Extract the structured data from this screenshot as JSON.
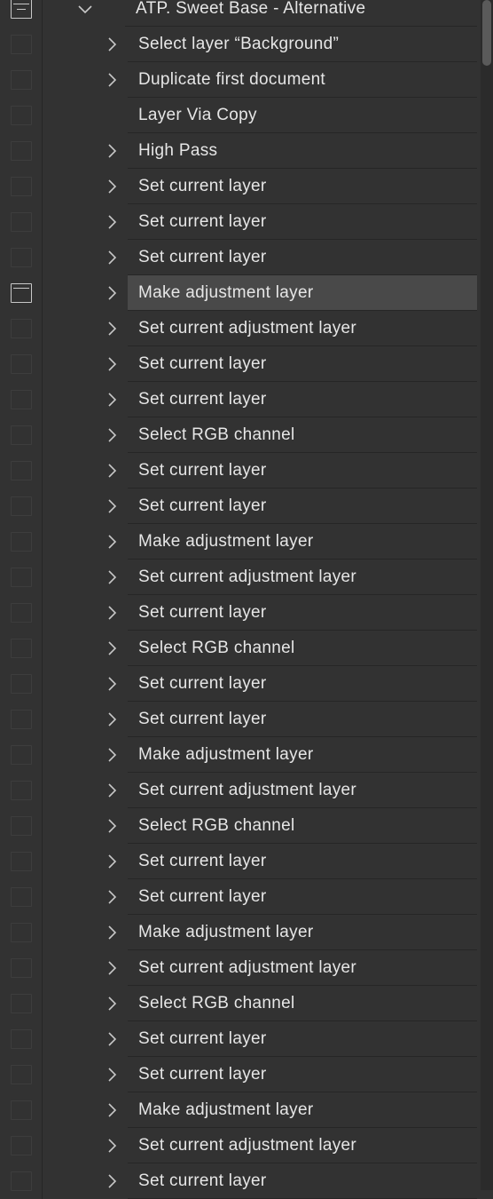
{
  "action_set": {
    "title": "ATP. Sweet Base - Alternative",
    "expanded": true
  },
  "steps": [
    {
      "label": "Select layer “Background”",
      "has_details": true,
      "modal": false,
      "selected": false
    },
    {
      "label": "Duplicate first document",
      "has_details": true,
      "modal": false,
      "selected": false
    },
    {
      "label": "Layer Via Copy",
      "has_details": false,
      "modal": false,
      "selected": false
    },
    {
      "label": "High Pass",
      "has_details": true,
      "modal": false,
      "selected": false
    },
    {
      "label": "Set current layer",
      "has_details": true,
      "modal": false,
      "selected": false
    },
    {
      "label": "Set current layer",
      "has_details": true,
      "modal": false,
      "selected": false
    },
    {
      "label": "Set current layer",
      "has_details": true,
      "modal": false,
      "selected": false
    },
    {
      "label": "Make adjustment layer",
      "has_details": true,
      "modal": true,
      "selected": true
    },
    {
      "label": "Set current adjustment layer",
      "has_details": true,
      "modal": false,
      "selected": false
    },
    {
      "label": "Set current layer",
      "has_details": true,
      "modal": false,
      "selected": false
    },
    {
      "label": "Set current layer",
      "has_details": true,
      "modal": false,
      "selected": false
    },
    {
      "label": "Select RGB channel",
      "has_details": true,
      "modal": false,
      "selected": false
    },
    {
      "label": "Set current layer",
      "has_details": true,
      "modal": false,
      "selected": false
    },
    {
      "label": "Set current layer",
      "has_details": true,
      "modal": false,
      "selected": false
    },
    {
      "label": "Make adjustment layer",
      "has_details": true,
      "modal": false,
      "selected": false
    },
    {
      "label": "Set current adjustment layer",
      "has_details": true,
      "modal": false,
      "selected": false
    },
    {
      "label": "Set current layer",
      "has_details": true,
      "modal": false,
      "selected": false
    },
    {
      "label": "Select RGB channel",
      "has_details": true,
      "modal": false,
      "selected": false
    },
    {
      "label": "Set current layer",
      "has_details": true,
      "modal": false,
      "selected": false
    },
    {
      "label": "Set current layer",
      "has_details": true,
      "modal": false,
      "selected": false
    },
    {
      "label": "Make adjustment layer",
      "has_details": true,
      "modal": false,
      "selected": false
    },
    {
      "label": "Set current adjustment layer",
      "has_details": true,
      "modal": false,
      "selected": false
    },
    {
      "label": "Select RGB channel",
      "has_details": true,
      "modal": false,
      "selected": false
    },
    {
      "label": "Set current layer",
      "has_details": true,
      "modal": false,
      "selected": false
    },
    {
      "label": "Set current layer",
      "has_details": true,
      "modal": false,
      "selected": false
    },
    {
      "label": "Make adjustment layer",
      "has_details": true,
      "modal": false,
      "selected": false
    },
    {
      "label": "Set current adjustment layer",
      "has_details": true,
      "modal": false,
      "selected": false
    },
    {
      "label": "Select RGB channel",
      "has_details": true,
      "modal": false,
      "selected": false
    },
    {
      "label": "Set current layer",
      "has_details": true,
      "modal": false,
      "selected": false
    },
    {
      "label": "Set current layer",
      "has_details": true,
      "modal": false,
      "selected": false
    },
    {
      "label": "Make adjustment layer",
      "has_details": true,
      "modal": false,
      "selected": false
    },
    {
      "label": "Set current adjustment layer",
      "has_details": true,
      "modal": false,
      "selected": false
    },
    {
      "label": "Set current layer",
      "has_details": true,
      "modal": false,
      "selected": false
    }
  ],
  "colors": {
    "panel_bg": "#323232",
    "row_divider": "#262626",
    "selected_bg": "#494949",
    "text": "#e6e6e6"
  }
}
